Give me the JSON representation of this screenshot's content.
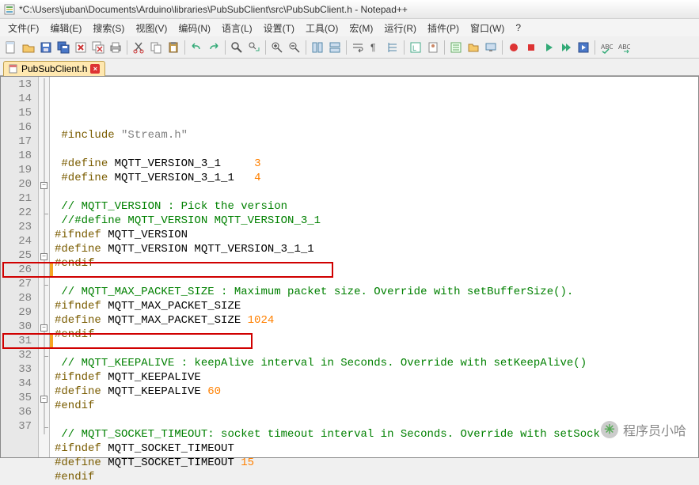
{
  "window": {
    "title": "*C:\\Users\\juban\\Documents\\Arduino\\libraries\\PubSubClient\\src\\PubSubClient.h - Notepad++"
  },
  "menu": {
    "file": "文件(F)",
    "edit": "编辑(E)",
    "search": "搜索(S)",
    "view": "视图(V)",
    "encoding": "编码(N)",
    "language": "语言(L)",
    "settings": "设置(T)",
    "tools": "工具(O)",
    "macro": "宏(M)",
    "run": "运行(R)",
    "plugins": "插件(P)",
    "window": "窗口(W)",
    "help": "?"
  },
  "tab": {
    "label": "PubSubClient.h"
  },
  "gutter_start": 13,
  "code": {
    "l13_a": "#include",
    "l13_b": " \"Stream.h\"",
    "l15_a": "#define",
    "l15_b": " MQTT_VERSION_3_1     ",
    "l15_c": "3",
    "l16_a": "#define",
    "l16_b": " MQTT_VERSION_3_1_1   ",
    "l16_c": "4",
    "l18": "// MQTT_VERSION : Pick the version",
    "l19": "//#define MQTT_VERSION MQTT_VERSION_3_1",
    "l20_a": "#ifndef",
    "l20_b": " MQTT_VERSION",
    "l21_a": "#define",
    "l21_b": " MQTT_VERSION MQTT_VERSION_3_1_1",
    "l22": "#endif",
    "l24": "// MQTT_MAX_PACKET_SIZE : Maximum packet size. Override with setBufferSize().",
    "l25_a": "#ifndef",
    "l25_b": " MQTT_MAX_PACKET_SIZE",
    "l26_a": "#define",
    "l26_b": " MQTT_MAX_PACKET_SIZE ",
    "l26_c": "1024",
    "l27": "#endif",
    "l29": "// MQTT_KEEPALIVE : keepAlive interval in Seconds. Override with setKeepAlive()",
    "l30_a": "#ifndef",
    "l30_b": " MQTT_KEEPALIVE",
    "l31_a": "#define",
    "l31_b": " MQTT_KEEPALIVE ",
    "l31_c": "60",
    "l32": "#endif",
    "l34": "// MQTT_SOCKET_TIMEOUT: socket timeout interval in Seconds. Override with setSock",
    "l35_a": "#ifndef",
    "l35_b": " MQTT_SOCKET_TIMEOUT",
    "l36_a": "#define",
    "l36_b": " MQTT_SOCKET_TIMEOUT ",
    "l36_c": "15",
    "l37": "#endif"
  },
  "watermark": {
    "text": "程序员小哈"
  }
}
